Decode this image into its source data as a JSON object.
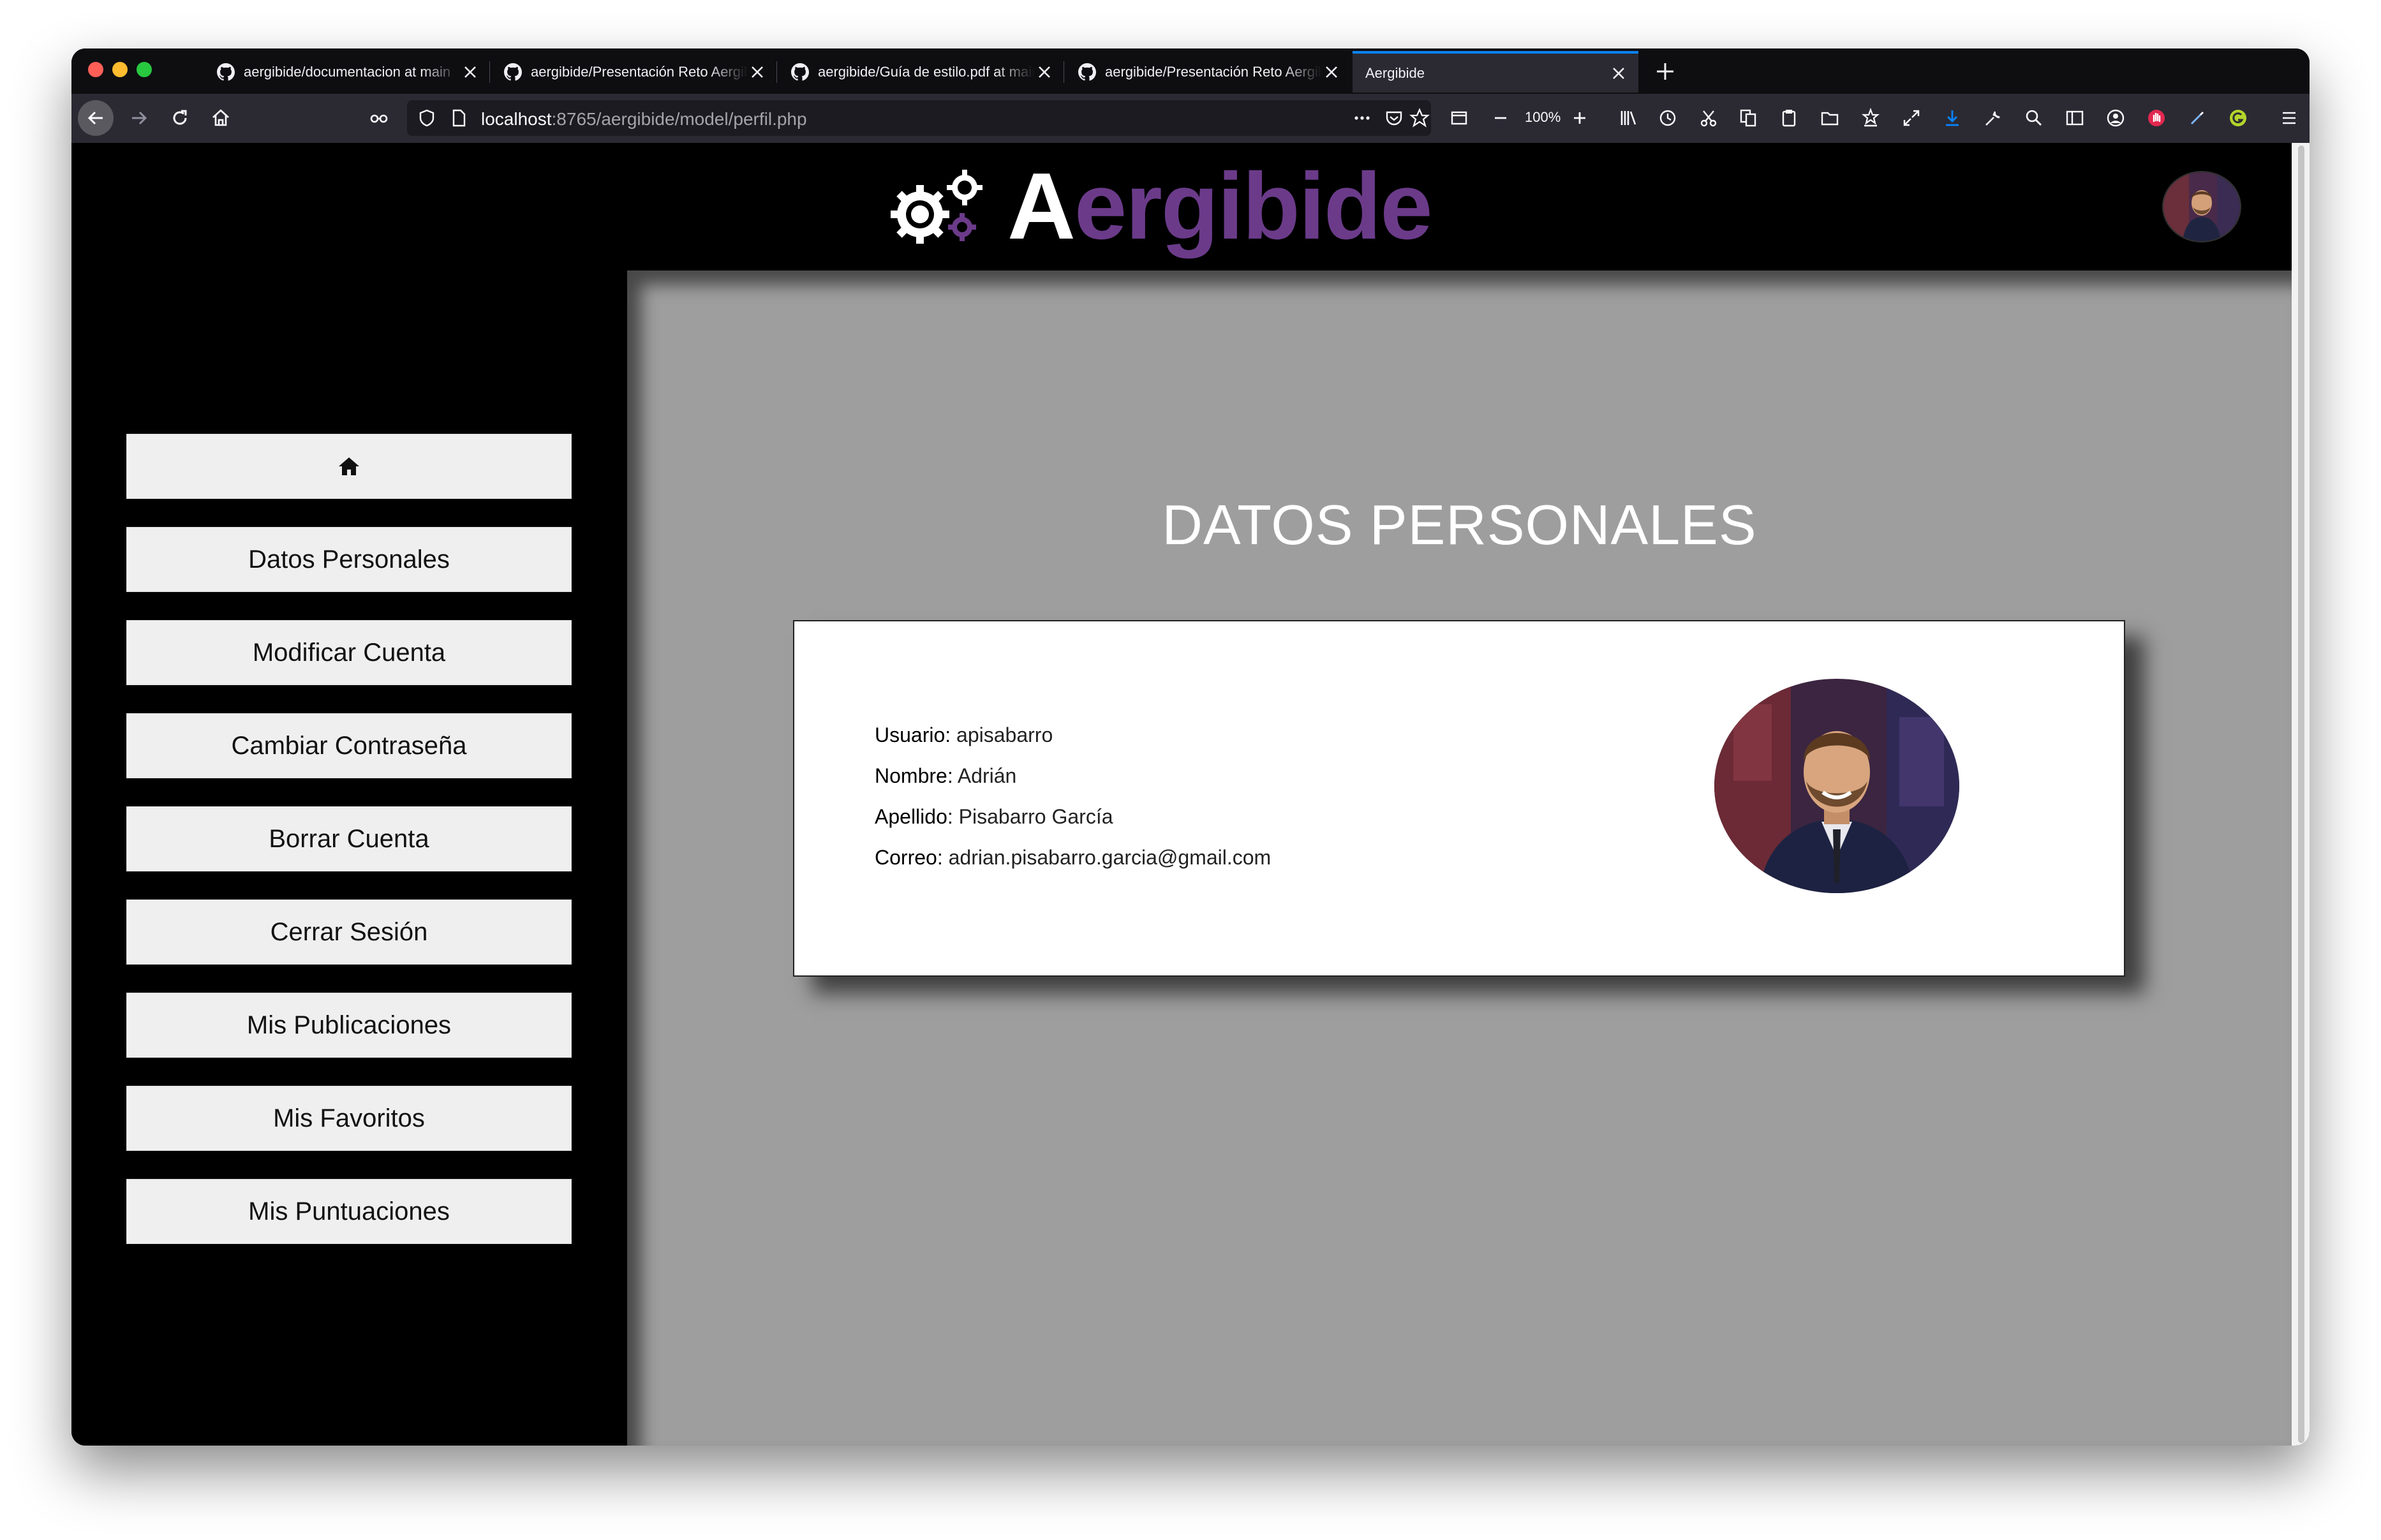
{
  "browser": {
    "tabs": [
      {
        "title": "aergibide/documentacion at main",
        "icon": "github-icon",
        "active": false
      },
      {
        "title": "aergibide/Presentación Reto Aergibide",
        "icon": "github-icon",
        "active": false
      },
      {
        "title": "aergibide/Guía de estilo.pdf at main",
        "icon": "github-icon",
        "active": false
      },
      {
        "title": "aergibide/Presentación Reto Aergibide",
        "icon": "github-icon",
        "active": false
      },
      {
        "title": "Aergibide",
        "icon": "",
        "active": true
      }
    ],
    "url": {
      "host": "localhost",
      "rest": ":8765/aergibide/model/perfil.php"
    },
    "zoom": "100%"
  },
  "site": {
    "logo": {
      "first_letter": "A",
      "rest_er": "er",
      "rest_gibide": "gibide"
    },
    "colors": {
      "brand_purple": "#6b3b8a",
      "content_bg": "#9e9e9e",
      "sidebar_bg": "#000000"
    }
  },
  "sidebar": {
    "home_icon": "home-icon",
    "items": [
      {
        "label": "Datos Personales"
      },
      {
        "label": "Modificar Cuenta"
      },
      {
        "label": "Cambiar Contraseña"
      },
      {
        "label": "Borrar Cuenta"
      },
      {
        "label": "Cerrar Sesión"
      },
      {
        "label": "Mis Publicaciones"
      },
      {
        "label": "Mis Favoritos"
      },
      {
        "label": "Mis Puntuaciones"
      }
    ]
  },
  "main": {
    "title": "DATOS PERSONALES",
    "profile": {
      "fields": [
        {
          "label": "Usuario:",
          "value": "apisabarro"
        },
        {
          "label": "Nombre:",
          "value": "Adrián"
        },
        {
          "label": "Apellido:",
          "value": "Pisabarro García"
        },
        {
          "label": "Correo:",
          "value": "adrian.pisabarro.garcia@gmail.com"
        }
      ]
    }
  }
}
